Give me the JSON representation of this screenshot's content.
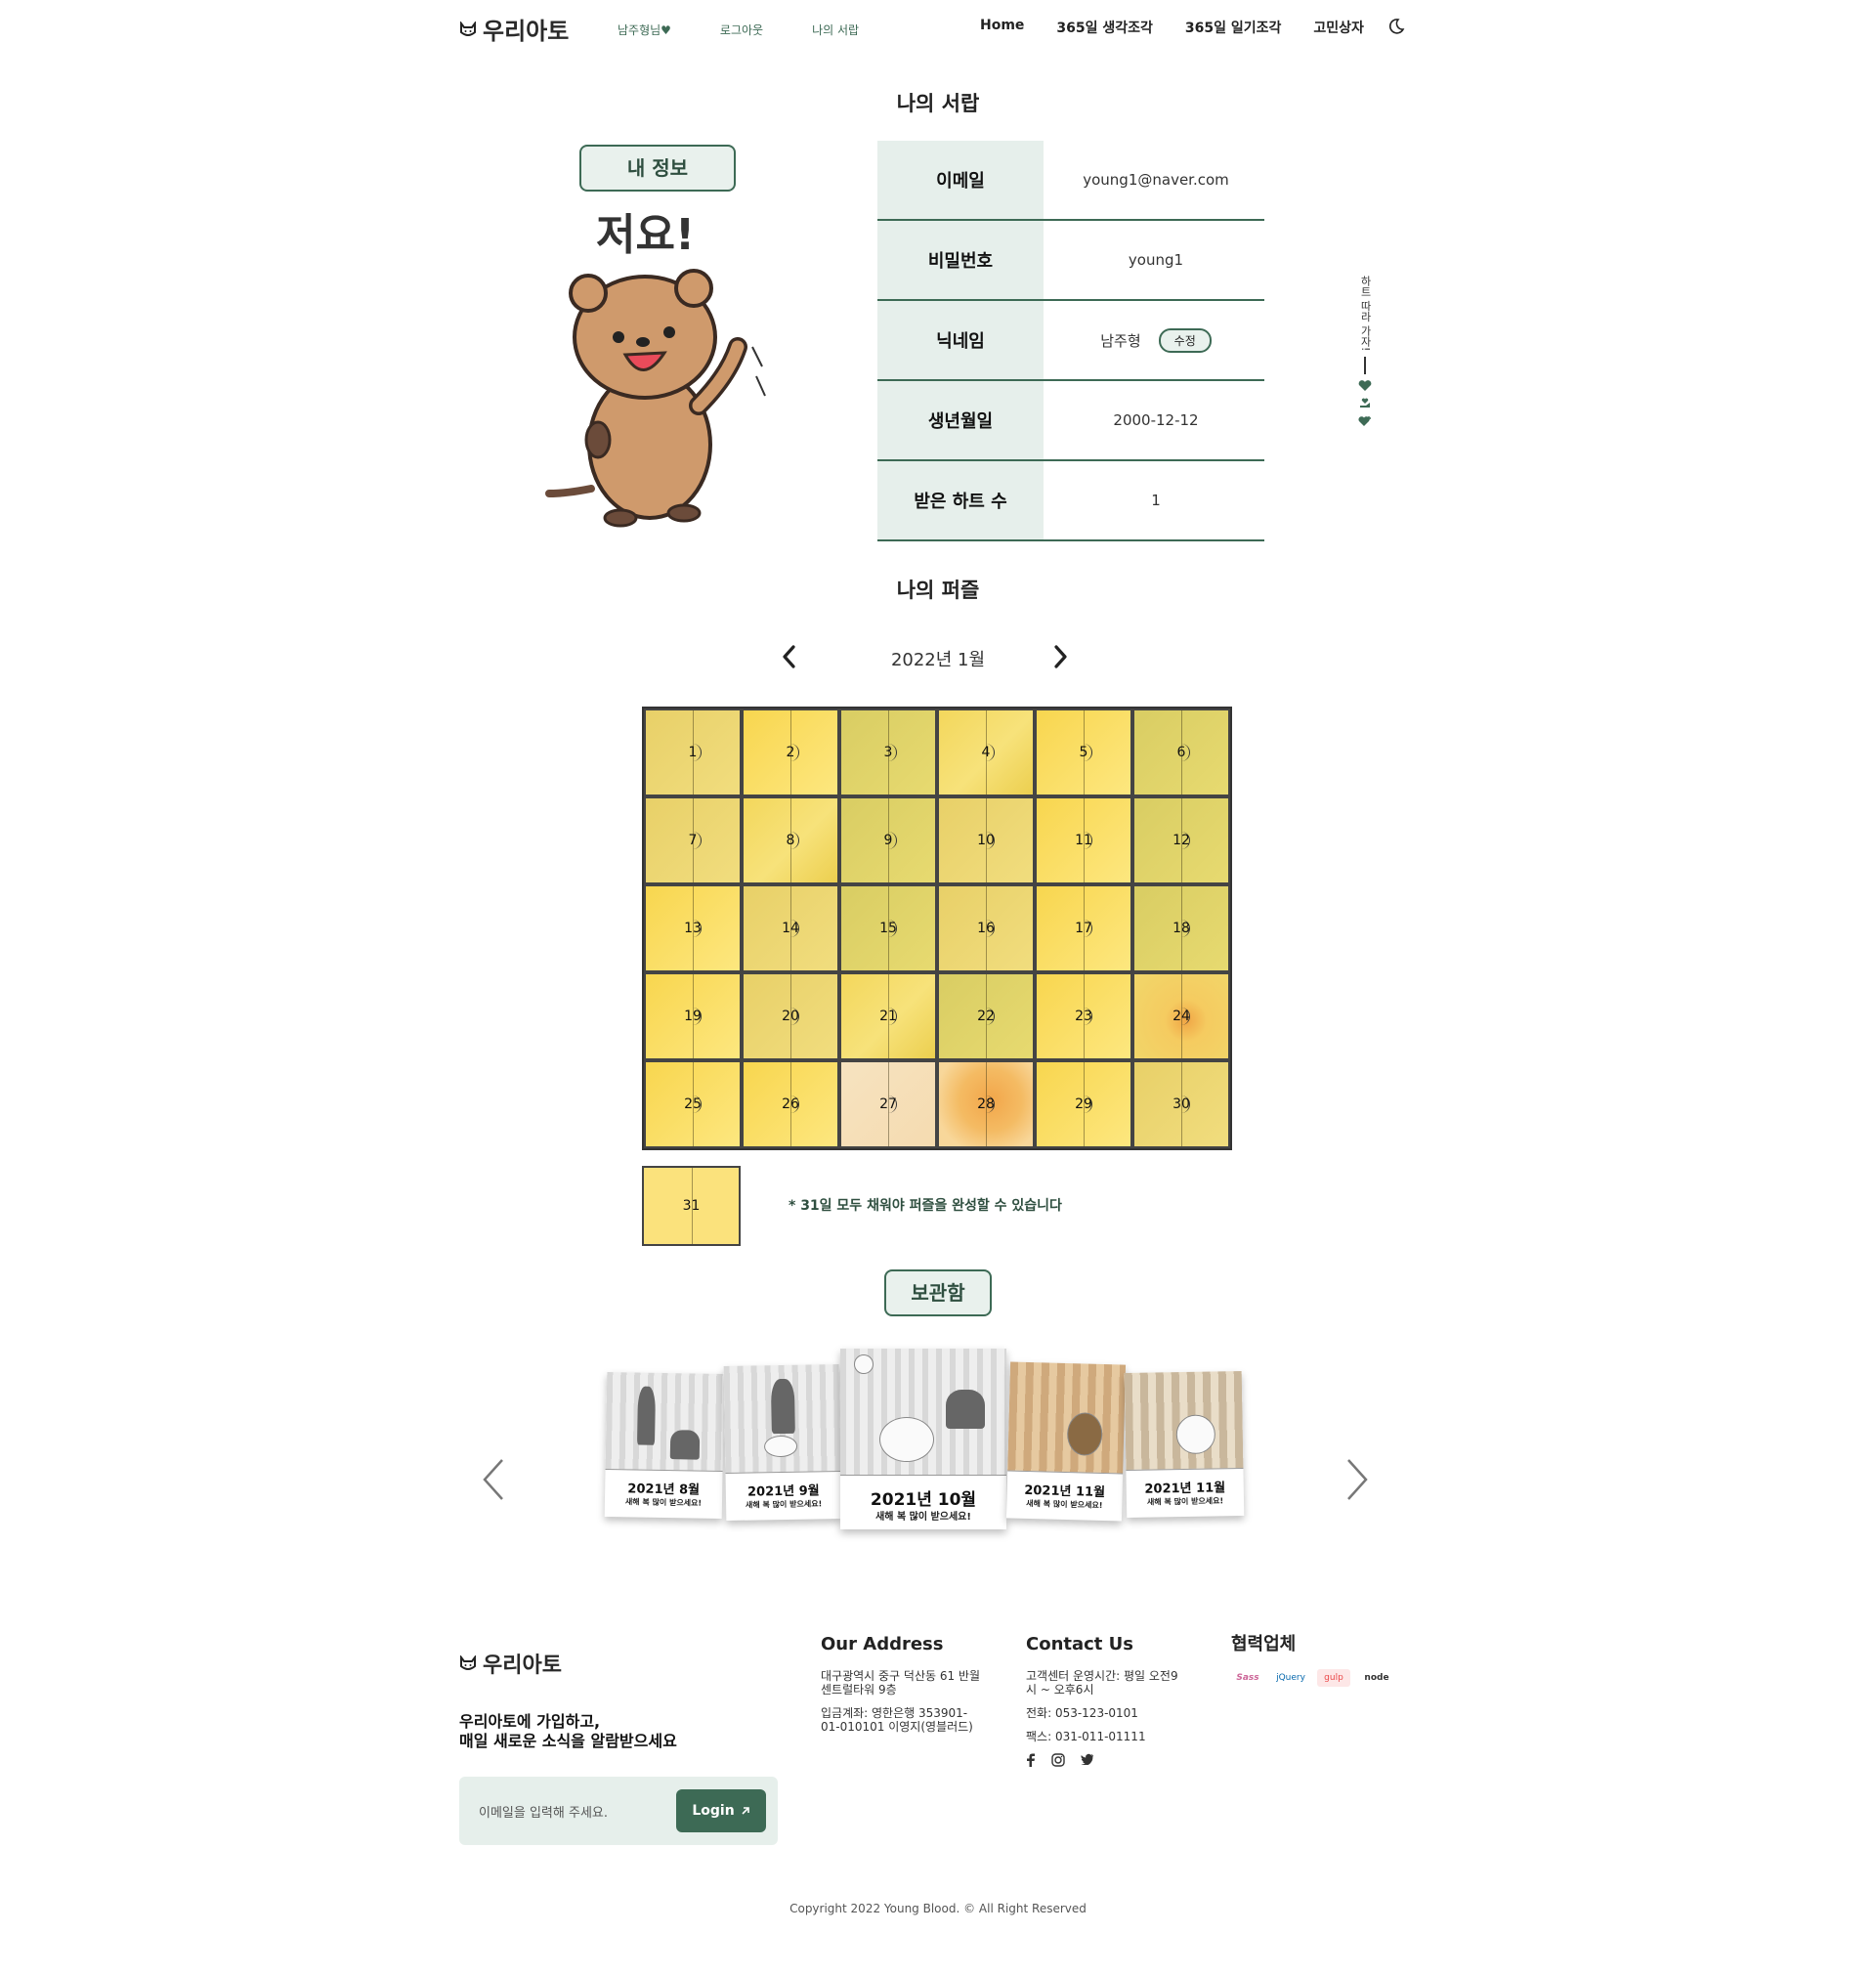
{
  "header": {
    "logo_text": "우리아토",
    "sub_links": [
      "남주형님♥",
      "로그아웃",
      "나의 서랍"
    ],
    "nav": [
      "Home",
      "365일 생각조각",
      "365일 일기조각",
      "고민상자"
    ]
  },
  "drawer": {
    "title": "나의 서랍",
    "info_button": "내 정보",
    "mascot_caption": "저요!",
    "rows": [
      {
        "label": "이메일",
        "value": "young1@naver.com"
      },
      {
        "label": "비밀번호",
        "value": "young1"
      },
      {
        "label": "닉네임",
        "value": "남주형",
        "action": "수정"
      },
      {
        "label": "생년월일",
        "value": "2000-12-12"
      },
      {
        "label": "받은 하트 수",
        "value": "1"
      }
    ]
  },
  "side": {
    "text": "하트 따라 가자!"
  },
  "puzzle": {
    "title": "나의 퍼즐",
    "month": "2022년 1월",
    "days": [
      "1",
      "2",
      "3",
      "4",
      "5",
      "6",
      "7",
      "8",
      "9",
      "10",
      "11",
      "12",
      "13",
      "14",
      "15",
      "16",
      "17",
      "18",
      "19",
      "20",
      "21",
      "22",
      "23",
      "24",
      "25",
      "26",
      "27",
      "28",
      "29",
      "30"
    ],
    "day31": "31",
    "notice": "* 31일 모두 채워야 퍼즐을 완성할 수 있습니다"
  },
  "storage": {
    "button": "보관함",
    "cards": [
      {
        "title": "2021년 8월",
        "subtitle": "새해 복 많이 받으세요!"
      },
      {
        "title": "2021년 9월",
        "subtitle": "새해 복 많이 받으세요!"
      },
      {
        "title": "2021년 10월",
        "subtitle": "새해 복 많이 받으세요!"
      },
      {
        "title": "2021년 11월",
        "subtitle": "새해 복 많이 받으세요!"
      },
      {
        "title": "2021년 11월",
        "subtitle": "새해 복 많이 받으세요!"
      }
    ]
  },
  "footer": {
    "logo_text": "우리아토",
    "join_line1": "우리아토에 가입하고,",
    "join_line2": "매일 새로운 소식을 알람받으세요",
    "email_placeholder": "이메일을 입력해 주세요.",
    "login_button": "Login",
    "address_title": "Our Address",
    "address_line1": "대구광역시 중구 덕산동 61 반월",
    "address_line2": "센트럴타워 9층",
    "account_line1": "입금계좌: 영한은행 353901-",
    "account_line2": "01-010101 이영지(영블러드)",
    "contact_title": "Contact Us",
    "contact_hours1": "고객센터 운영시간: 평일 오전9",
    "contact_hours2": "시 ~ 오후6시",
    "phone": "전화: 053-123-0101",
    "fax": "팩스: 031-011-01111",
    "partners_title": "협력업체",
    "partners": [
      "Sass",
      "jQuery",
      "gulp",
      "node"
    ],
    "copyright": "Copyright 2022 Young Blood. © All Right Reserved"
  },
  "colors": {
    "accent": "#3d6a55",
    "accent_light": "#e6efeb",
    "puzzle_yellow": "#f3d75c"
  }
}
